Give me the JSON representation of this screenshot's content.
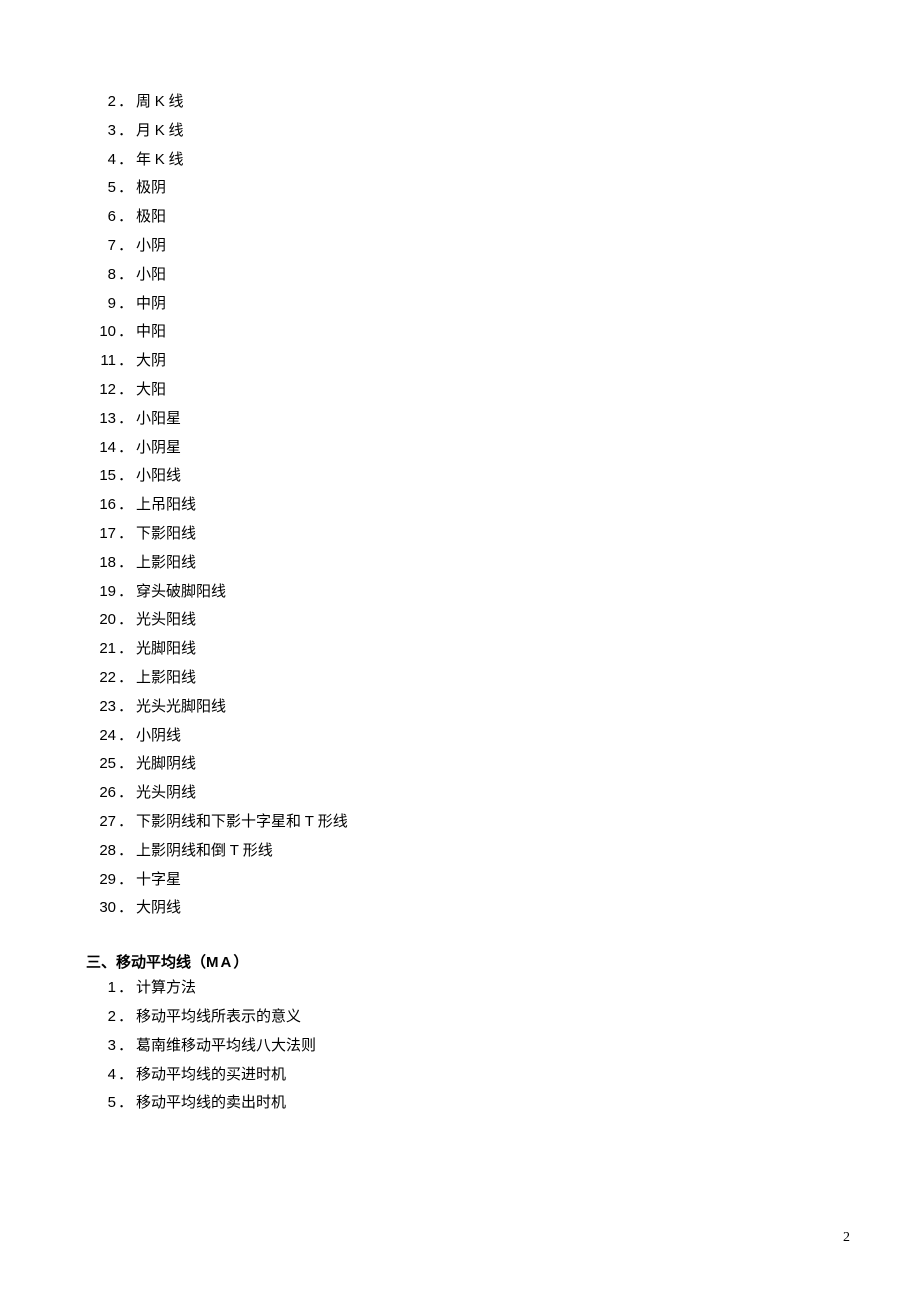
{
  "list1": [
    {
      "num": "2",
      "label": "周 K 线"
    },
    {
      "num": "3",
      "label": "月 K 线"
    },
    {
      "num": "4",
      "label": "年 K 线"
    },
    {
      "num": "5",
      "label": "极阴"
    },
    {
      "num": "6",
      "label": "极阳"
    },
    {
      "num": "7",
      "label": "小阴"
    },
    {
      "num": "8",
      "label": "小阳"
    },
    {
      "num": "9",
      "label": "中阴"
    },
    {
      "num": "10",
      "label": "中阳"
    },
    {
      "num": "11",
      "label": " 大阴"
    },
    {
      "num": "12",
      "label": " 大阳"
    },
    {
      "num": "13",
      "label": "小阳星"
    },
    {
      "num": "14",
      "label": "小阴星"
    },
    {
      "num": "15",
      "label": "小阳线"
    },
    {
      "num": "16",
      "label": "上吊阳线"
    },
    {
      "num": "17",
      "label": "下影阳线"
    },
    {
      "num": "18",
      "label": "上影阳线"
    },
    {
      "num": "19",
      "label": "穿头破脚阳线"
    },
    {
      "num": "20",
      "label": "光头阳线"
    },
    {
      "num": "21",
      "label": "光脚阳线"
    },
    {
      "num": "22",
      "label": "上影阳线"
    },
    {
      "num": "23",
      "label": "光头光脚阳线"
    },
    {
      "num": "24",
      "label": "小阴线"
    },
    {
      "num": "25",
      "label": "光脚阴线"
    },
    {
      "num": "26",
      "label": "光头阴线"
    },
    {
      "num": "27",
      "label": "下影阴线和下影十字星和 T 形线"
    },
    {
      "num": "28",
      "label": "上影阴线和倒 T 形线"
    },
    {
      "num": "29",
      "label": "十字星"
    },
    {
      "num": "30",
      "label": "大阴线"
    }
  ],
  "section3": {
    "prefix": "三、移动平均线（",
    "latin": "MA",
    "suffix": "）"
  },
  "list2": [
    {
      "num": "1",
      "label": "计算方法"
    },
    {
      "num": "2",
      "label": "移动平均线所表示的意义"
    },
    {
      "num": "3",
      "label": "葛南维移动平均线八大法则"
    },
    {
      "num": "4",
      "label": "移动平均线的买进时机"
    },
    {
      "num": "5",
      "label": "移动平均线的卖出时机"
    }
  ],
  "page_number": "2"
}
